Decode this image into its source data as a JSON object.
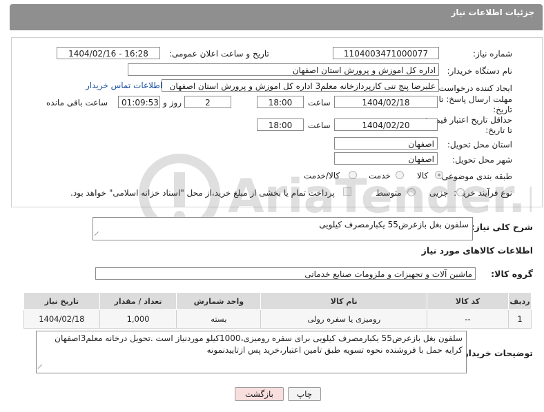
{
  "header": {
    "title": "جزئیات اطلاعات نیاز"
  },
  "form": {
    "need_number_label": "شماره نیاز:",
    "need_number": "1104003471000077",
    "announce_label": "تاریخ و ساعت اعلان عمومی:",
    "announce_value": "1404/02/16 - 16:28",
    "buyer_org_label": "نام دستگاه خریدار:",
    "buyer_org": "اداره کل اموزش و پرورش استان اصفهان",
    "requester_label": "ایجاد کننده درخواست:",
    "requester": "علیرضا پنج تنی کارپردازخانه معلم3 اداره کل اموزش و پرورش استان اصفهان",
    "contact_link": "اطلاعات تماس خریدار",
    "deadline_label_1": "مهلت ارسال پاسخ: تا",
    "deadline_label_2": "تاریخ:",
    "deadline_date": "1404/02/18",
    "time_label": "ساعت",
    "deadline_time": "18:00",
    "days_value": "2",
    "days_label": "روز و",
    "remaining_time": "01:09:53",
    "remaining_label": "ساعت باقی مانده",
    "validity_label_1": "حداقل تاریخ اعتبار قیمت:",
    "validity_label_2": "تا تاریخ:",
    "validity_date": "1404/02/20",
    "validity_time_label": "ساعت",
    "validity_time": "18:00",
    "province_label": "استان محل تحویل:",
    "province": "اصفهان",
    "city_label": "شهر محل تحویل:",
    "city": "اصفهان",
    "category_label": "طبقه بندی موضوعی:",
    "category_options": [
      "کالا",
      "خدمت",
      "کالا/خدمت"
    ],
    "category_selected": "کالا",
    "process_label": "نوع فرآیند خرید :",
    "process_options": [
      "جزیی",
      "متوسط"
    ],
    "process_note": "پرداخت تمام یا بخشی از مبلغ خرید،از محل \"اسناد خزانه اسلامی\" خواهد بود."
  },
  "description": {
    "label": "شرح کلی نیاز:",
    "value": "سلفون بغل بازعرض55 یکبارمصرف کیلویی"
  },
  "goods": {
    "section_title": "اطلاعات کالاهای مورد نیاز",
    "group_label": "گروه کالا:",
    "group_value": "ماشین آلات و تجهیزات و ملزومات صنایع خدماتی",
    "table": {
      "headers": [
        "ردیف",
        "کد کالا",
        "نام کالا",
        "واحد شمارش",
        "تعداد / مقدار",
        "تاریخ نیاز"
      ],
      "rows": [
        [
          "1",
          "--",
          "رومیزی یا سفره رولی",
          "بسته",
          "1,000",
          "1404/02/18"
        ]
      ]
    }
  },
  "buyer_notes": {
    "label": "توضیحات خریدار:",
    "value": "سلفون بغل بازعرض55 یکبارمصرف کیلویی برای سفره رومیزی،1000کیلو موردنیاز است .تحویل درخانه معلم3اصفهان کرایه حمل با فروشنده نحوه تسویه طبق تامین اعتبار،خرید پس ازتاییدنمونه"
  },
  "buttons": {
    "print": "چاپ",
    "back": "بازگشت"
  },
  "watermark": {
    "text": "AriaTender.net"
  },
  "colors": {
    "header_bg": "#8f8f8f",
    "link": "#1a4fa0",
    "back_button_bg": "#f9dede"
  }
}
